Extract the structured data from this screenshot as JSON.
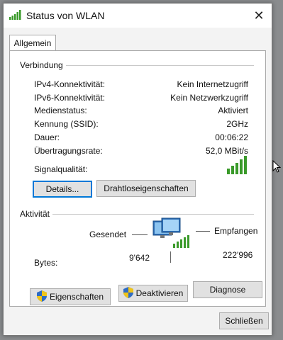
{
  "window": {
    "title": "Status von WLAN",
    "close_label": "✕"
  },
  "tabs": [
    {
      "label": "Allgemein"
    }
  ],
  "connection": {
    "group_label": "Verbindung",
    "rows": [
      {
        "label": "IPv4-Konnektivität:",
        "value": "Kein Internetzugriff"
      },
      {
        "label": "IPv6-Konnektivität:",
        "value": "Kein Netzwerkzugriff"
      },
      {
        "label": "Medienstatus:",
        "value": "Aktiviert"
      },
      {
        "label": "Kennung (SSID):",
        "value": "2GHz"
      },
      {
        "label": "Dauer:",
        "value": "00:06:22"
      },
      {
        "label": "Übertragungsrate:",
        "value": "52,0 MBit/s"
      }
    ],
    "signal_label": "Signalqualität:",
    "signal_bars_filled": 5,
    "signal_bars_total": 5,
    "details_button": "Details...",
    "wireless_props_button": "Drahtloseigenschaften"
  },
  "activity": {
    "group_label": "Aktivität",
    "sent_label": "Gesendet",
    "received_label": "Empfangen",
    "bytes_label": "Bytes:",
    "bytes_sent": "9'642",
    "bytes_received": "222'996"
  },
  "buttons": {
    "properties": "Eigenschaften",
    "disable": "Deaktivieren",
    "diagnose": "Diagnose",
    "close": "Schließen"
  },
  "colors": {
    "signal_green": "#3a9a2a",
    "default_border": "#0078d7"
  },
  "icons": {
    "title": "wifi-signal-icon",
    "shield": "uac-shield-icon",
    "network": "network-computers-icon"
  }
}
